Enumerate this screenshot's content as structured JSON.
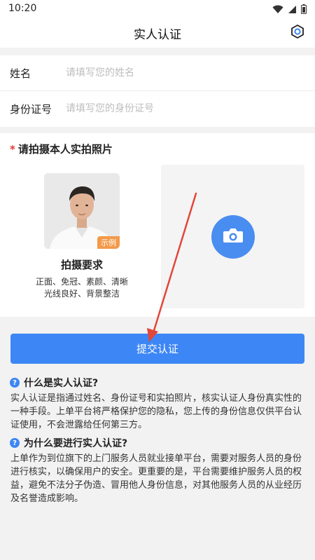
{
  "status": {
    "time": "10:20"
  },
  "header": {
    "title": "实人认证"
  },
  "form": {
    "name_label": "姓名",
    "name_placeholder": "请填写您的姓名",
    "id_label": "身份证号",
    "id_placeholder": "请填写您的身份证号"
  },
  "photo": {
    "required_mark": "*",
    "title": "请拍摄本人实拍照片",
    "sample_badge": "示例",
    "requirements_title": "拍摄要求",
    "requirements_line1": "正面、免冠、素颜、清晰",
    "requirements_line2": "光线良好、背景整洁"
  },
  "submit_label": "提交认证",
  "faq": [
    {
      "question": "什么是实人认证?",
      "answer": "实人认证是指通过姓名、身份证号和实拍照片，核实认证人身份真实性的一种手段。上单平台将严格保护您的隐私，您上传的身份信息仅供平台认证使用，不会泄露给任何第三方。"
    },
    {
      "question": "为什么要进行实人认证?",
      "answer": "上单作为到位旗下的上门服务人员就业接单平台，需要对服务人员的身份进行核实，以确保用户的安全。更重要的是，平台需要维护服务人员的权益，避免不法分子伪造、冒用他人身份信息，对其他服务人员的从业经历及名誉造成影响。"
    }
  ],
  "colors": {
    "primary": "#3d86f5",
    "required": "#e53935",
    "arrow": "#e2463b",
    "badge": "#f29a4a"
  }
}
